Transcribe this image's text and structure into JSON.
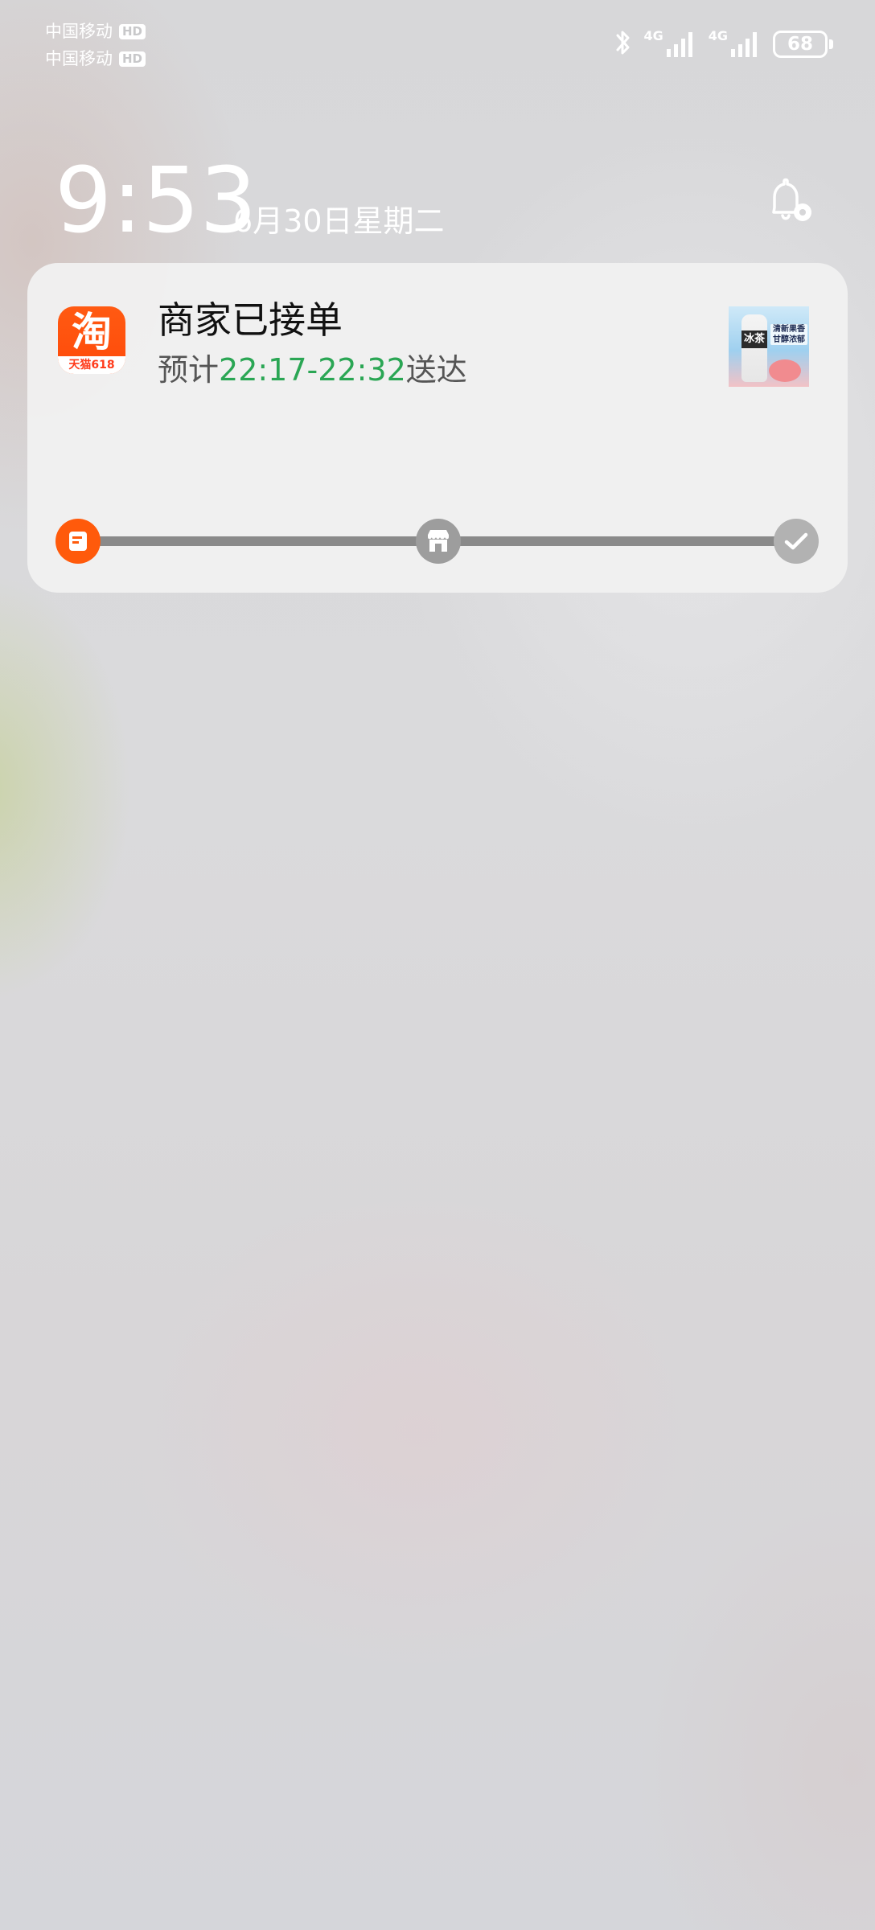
{
  "status_bar": {
    "carrier_1": "中国移动",
    "carrier_2": "中国移动",
    "hd_badge": "HD",
    "network_1": "4G",
    "network_2": "4G",
    "battery_level": "68"
  },
  "lock_screen": {
    "time": "9:53",
    "date": "6月30日星期二"
  },
  "notification": {
    "app_icon_glyph": "淘",
    "app_icon_caption": "天猫618",
    "title": "商家已接单",
    "subtitle_prefix": "预计",
    "eta": "22:17-22:32",
    "subtitle_suffix": "送达",
    "thumbnail_brand": "冰茶",
    "thumbnail_tagline": "清新果香 甘醇浓郁",
    "progress": {
      "steps": [
        "order-accepted",
        "store",
        "delivered"
      ],
      "current_step": 0
    }
  },
  "colors": {
    "accent_orange": "#ff5a0b",
    "eta_green": "#2aa654",
    "track_gray": "#8a8a8a"
  },
  "icons": {
    "bluetooth": "bluetooth-icon",
    "signal": "signal-icon",
    "notification_settings": "bell-gear-icon",
    "order": "order-icon",
    "store": "store-icon",
    "check": "check-icon"
  }
}
